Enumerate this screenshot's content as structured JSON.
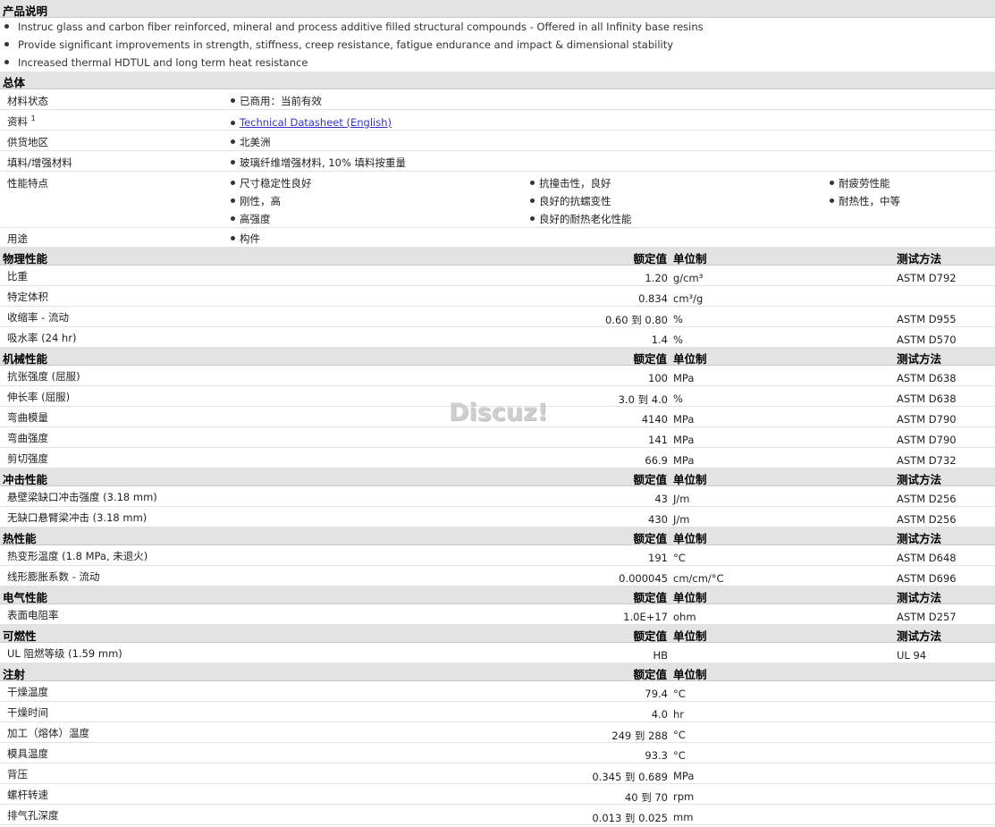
{
  "product_description": {
    "title": "产品说明",
    "bullets": [
      "Instruc glass and carbon fiber reinforced, mineral and process additive filled structural compounds - Offered in all Infinity base resins",
      "Provide significant improvements in strength, stiffness, creep resistance, fatigue endurance and impact & dimensional stability",
      "Increased thermal HDTUL and long term heat resistance"
    ]
  },
  "general": {
    "title": "总体",
    "rows": [
      {
        "label": "材料状态",
        "items": [
          "已商用：当前有效"
        ]
      },
      {
        "label": "资料",
        "sup": "1",
        "items": [
          "Technical Datasheet (English)"
        ],
        "link": true
      },
      {
        "label": "供货地区",
        "items": [
          "北美洲"
        ]
      },
      {
        "label": "填料/增强材料",
        "items": [
          "玻璃纤维增强材料, 10% 填料按重量"
        ]
      },
      {
        "label": "性能特点",
        "columns": [
          [
            "尺寸稳定性良好",
            "刚性，高",
            "高强度"
          ],
          [
            "抗撞击性，良好",
            "良好的抗蠕变性",
            "良好的耐热老化性能"
          ],
          [
            "耐疲劳性能",
            "耐热性，中等"
          ]
        ]
      },
      {
        "label": "用途",
        "items": [
          "构件"
        ]
      }
    ]
  },
  "headers": {
    "value": "额定值",
    "unit": "单位制",
    "method": "测试方法"
  },
  "sections": [
    {
      "title": "物理性能",
      "show_method": true,
      "rows": [
        {
          "label": "比重",
          "value": "1.20",
          "unit": "g/cm³",
          "method": "ASTM D792"
        },
        {
          "label": "特定体积",
          "value": "0.834",
          "unit": "cm³/g",
          "method": ""
        },
        {
          "label": "收缩率  - 流动",
          "value": "0.60 到  0.80",
          "unit": "%",
          "method": "ASTM D955"
        },
        {
          "label": "吸水率  (24 hr)",
          "value": "1.4",
          "unit": "%",
          "method": "ASTM D570"
        }
      ]
    },
    {
      "title": "机械性能",
      "show_method": true,
      "rows": [
        {
          "label": "抗张强度  (屈服)",
          "value": "100",
          "unit": "MPa",
          "method": "ASTM D638"
        },
        {
          "label": "伸长率  (屈服)",
          "value": "3.0 到  4.0",
          "unit": "%",
          "method": "ASTM D638"
        },
        {
          "label": "弯曲模量",
          "value": "4140",
          "unit": "MPa",
          "method": "ASTM D790"
        },
        {
          "label": "弯曲强度",
          "value": "141",
          "unit": "MPa",
          "method": "ASTM D790"
        },
        {
          "label": "剪切强度",
          "value": "66.9",
          "unit": "MPa",
          "method": "ASTM D732"
        }
      ]
    },
    {
      "title": "冲击性能",
      "show_method": true,
      "rows": [
        {
          "label": "悬壁梁缺口冲击强度  (3.18 mm)",
          "value": "43",
          "unit": "J/m",
          "method": "ASTM D256"
        },
        {
          "label": "无缺口悬臂梁冲击  (3.18 mm)",
          "value": "430",
          "unit": "J/m",
          "method": "ASTM D256"
        }
      ]
    },
    {
      "title": "热性能",
      "show_method": true,
      "rows": [
        {
          "label": "热变形温度  (1.8 MPa, 未退火)",
          "value": "191",
          "unit": "°C",
          "method": "ASTM D648"
        },
        {
          "label": "线形膨胀系数  - 流动",
          "value": "0.000045",
          "unit": "cm/cm/°C",
          "method": "ASTM D696"
        }
      ]
    },
    {
      "title": "电气性能",
      "show_method": true,
      "rows": [
        {
          "label": "表面电阻率",
          "value": "1.0E+17",
          "unit": "ohm",
          "method": "ASTM D257"
        }
      ]
    },
    {
      "title": "可燃性",
      "show_method": true,
      "rows": [
        {
          "label": "UL 阻燃等级  (1.59 mm)",
          "value": "HB",
          "unit": "",
          "method": "UL 94"
        }
      ]
    },
    {
      "title": "注射",
      "show_method": false,
      "rows": [
        {
          "label": "干燥温度",
          "value": "79.4",
          "unit": "°C",
          "method": ""
        },
        {
          "label": "干燥时间",
          "value": "4.0",
          "unit": "hr",
          "method": ""
        },
        {
          "label": "加工（熔体）温度",
          "value": "249 到  288",
          "unit": "°C",
          "method": ""
        },
        {
          "label": "模具温度",
          "value": "93.3",
          "unit": "°C",
          "method": ""
        },
        {
          "label": "背压",
          "value": "0.345 到  0.689",
          "unit": "MPa",
          "method": ""
        },
        {
          "label": "螺杆转速",
          "value": "40 到  70",
          "unit": "rpm",
          "method": ""
        },
        {
          "label": "排气孔深度",
          "value": "0.013 到  0.025",
          "unit": "mm",
          "method": ""
        }
      ]
    }
  ],
  "watermark": "Discuz!"
}
